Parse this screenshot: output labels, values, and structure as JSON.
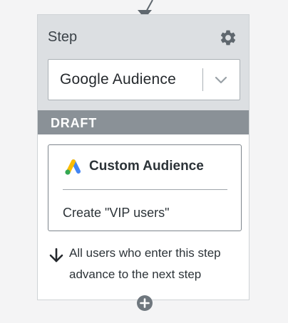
{
  "step": {
    "label": "Step",
    "settings_icon": "gear-icon"
  },
  "select": {
    "value": "Google Audience",
    "chevron_icon": "chevron-down-icon"
  },
  "status": {
    "label": "DRAFT"
  },
  "action": {
    "logo_icon": "google-ads-icon",
    "title": "Custom Audience",
    "description": "Create \"VIP users\""
  },
  "advance": {
    "icon": "arrow-down-icon",
    "text": "All users who enter this step advance to the next step"
  },
  "add": {
    "icon": "plus-circle-icon"
  },
  "colors": {
    "header_bg": "#dcdfe2",
    "status_bg": "#8a9197",
    "text": "#2c3338",
    "icon_gray": "#5f676e"
  }
}
